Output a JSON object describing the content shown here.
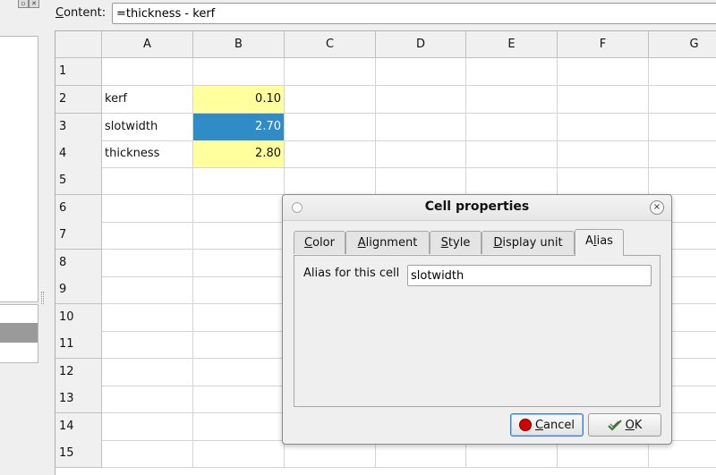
{
  "content_bar": {
    "label_underlined": "C",
    "label_rest": "ontent:",
    "value": "=thickness - kerf"
  },
  "grid": {
    "columns": [
      "A",
      "B",
      "C",
      "D",
      "E",
      "F",
      "G"
    ],
    "rows": [
      "1",
      "2",
      "3",
      "4",
      "5",
      "6",
      "7",
      "8",
      "9",
      "10",
      "11",
      "12",
      "13",
      "14",
      "15"
    ],
    "cells": {
      "A2": "kerf",
      "B2": "0.10",
      "A3": "slotwidth",
      "B3": "2.70",
      "A4": "thickness",
      "B4": "2.80"
    }
  },
  "dialog": {
    "title": "Cell properties",
    "close_symbol": "×",
    "tabs": [
      {
        "u": "C",
        "rest": "olor"
      },
      {
        "u": "A",
        "rest": "lignment"
      },
      {
        "u": "S",
        "rest": "tyle"
      },
      {
        "u": "D",
        "rest": "isplay unit"
      },
      {
        "pre": "A",
        "u": "l",
        "rest": "ias"
      }
    ],
    "alias_label": "Alias for this cell",
    "alias_value": "slotwidth",
    "cancel": {
      "u": "C",
      "rest": "ancel"
    },
    "ok": {
      "u": "O",
      "rest": "K"
    }
  },
  "colors": {
    "selected_cell": "#308cc6",
    "alias_cells": "#ffff9e",
    "cancel_icon": "#d40000"
  },
  "icons": {
    "cancel": "stop-circle-icon",
    "ok": "check-hand-icon",
    "close": "close-circle-icon"
  }
}
